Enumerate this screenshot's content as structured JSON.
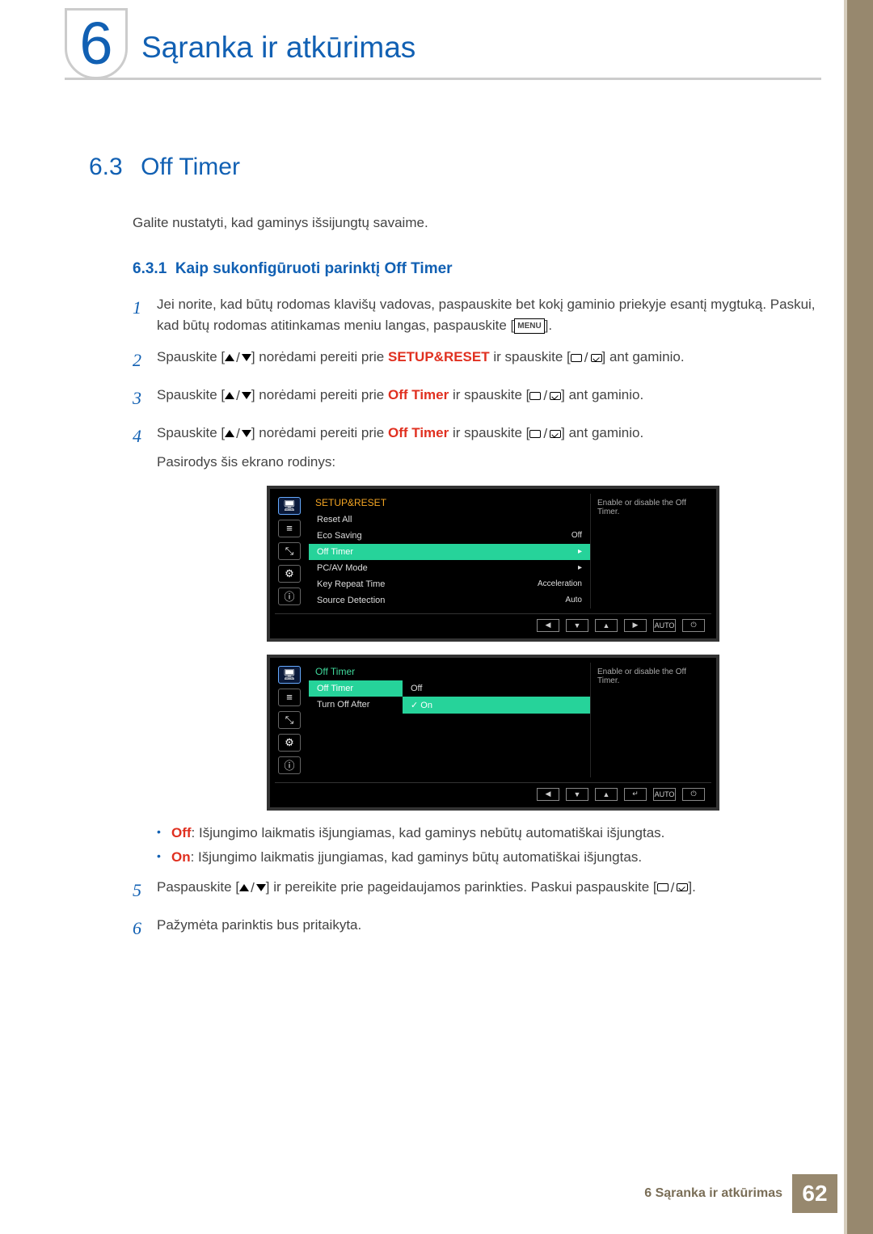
{
  "chapter": {
    "number": "6",
    "title": "Sąranka ir atkūrimas"
  },
  "section": {
    "number": "6.3",
    "title": "Off Timer"
  },
  "intro": "Galite nustatyti, kad gaminys išsijungtų savaime.",
  "subsection": {
    "number": "6.3.1",
    "title": "Kaip sukonfigūruoti parinktį Off Timer"
  },
  "steps": {
    "s1": {
      "a": "Jei norite, kad būtų rodomas klavišų vadovas, paspauskite bet kokį gaminio priekyje esantį mygtuką. Paskui, kad būtų rodomas atitinkamas meniu langas, paspauskite [",
      "b": "].",
      "menu": "MENU"
    },
    "s2": {
      "pre": "Spauskite [",
      "mid": "] norėdami pereiti prie ",
      "kw": "SETUP&RESET",
      "post1": " ir spauskite [",
      "post2": "] ant gaminio."
    },
    "s3": {
      "pre": "Spauskite [",
      "mid": "] norėdami pereiti prie ",
      "kw": "Off Timer",
      "post1": " ir spauskite [",
      "post2": "] ant gaminio."
    },
    "s4": {
      "pre": "Spauskite [",
      "mid": "] norėdami pereiti prie ",
      "kw": "Off Timer",
      "post1": " ir spauskite [",
      "post2": "] ant gaminio.",
      "after": "Pasirodys šis ekrano rodinys:"
    },
    "s5": {
      "pre": "Paspauskite [",
      "mid": "] ir pereikite prie pageidaujamos parinkties. Paskui paspauskite [",
      "post": "]."
    },
    "s6": "Pažymėta parinktis bus pritaikyta."
  },
  "osd1": {
    "title": "SETUP&RESET",
    "rows": [
      {
        "label": "Reset All",
        "value": ""
      },
      {
        "label": "Eco Saving",
        "value": "Off"
      },
      {
        "label": "Off Timer",
        "value": "▸",
        "hl": true
      },
      {
        "label": "PC/AV Mode",
        "value": "▸"
      },
      {
        "label": "Key Repeat Time",
        "value": "Acceleration"
      },
      {
        "label": "Source Detection",
        "value": "Auto"
      }
    ],
    "help": "Enable or disable the Off Timer.",
    "nav": [
      "◀",
      "▼",
      "▲",
      "▶",
      "AUTO",
      "⏻"
    ]
  },
  "osd2": {
    "title": "Off Timer",
    "rows": [
      {
        "label": "Off Timer",
        "hl": true
      },
      {
        "label": "Turn Off After"
      }
    ],
    "options": [
      {
        "label": "Off",
        "sel": false
      },
      {
        "label": "On",
        "sel": true,
        "check": "✓"
      }
    ],
    "help": "Enable or disable the Off Timer.",
    "nav": [
      "◀",
      "▼",
      "▲",
      "↵",
      "AUTO",
      "⏻"
    ]
  },
  "bullets": {
    "off": {
      "kw": "Off",
      "text": ": Išjungimo laikmatis išjungiamas, kad gaminys nebūtų automatiškai išjungtas."
    },
    "on": {
      "kw": "On",
      "text": ": Išjungimo laikmatis įjungiamas, kad gaminys būtų automatiškai išjungtas."
    }
  },
  "footer": {
    "text": "6 Sąranka ir atkūrimas",
    "page": "62"
  }
}
